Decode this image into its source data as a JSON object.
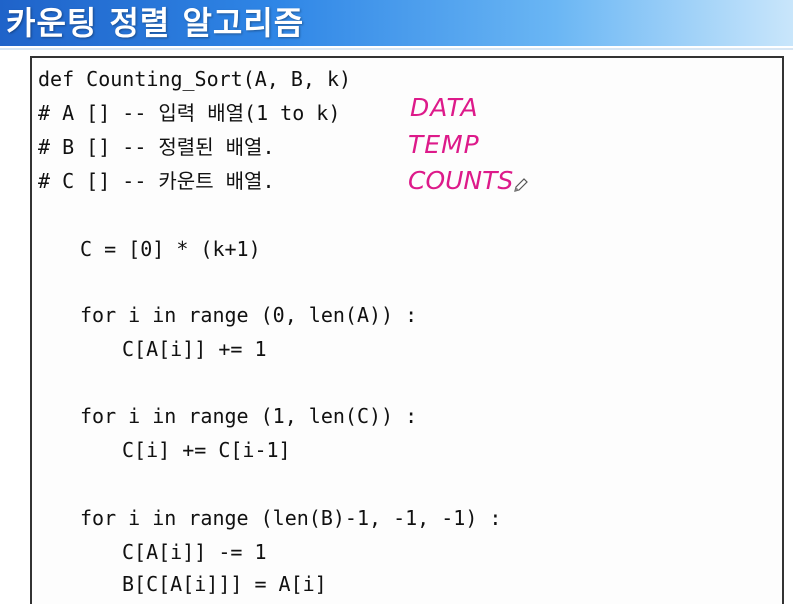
{
  "header": {
    "title": "카운팅 정렬 알고리즘"
  },
  "code": {
    "lines": [
      "def Counting_Sort(A, B, k)",
      "# A [] -- 입력 배열(1 to k)",
      "# B [] -- 정렬된 배열.",
      "# C [] -- 카운트 배열.",
      "C = [0] * (k+1)",
      "for i in range (0, len(A)) :",
      "C[A[i]] += 1",
      "for i in range (1, len(C)) :",
      "C[i] += C[i-1]",
      "for i in range (len(B)-1, -1, -1) :",
      "C[A[i]] -= 1",
      "B[C[A[i]]] = A[i]"
    ]
  },
  "annotations": {
    "data": "DATA",
    "temp": "TEMP",
    "counts": "COUNTS"
  },
  "colors": {
    "annotation": "#dd1a8a",
    "title_bar_start": "#1f63c9",
    "title_bar_end": "#c9e6fb"
  },
  "icons": {
    "cursor": "pencil-icon"
  }
}
